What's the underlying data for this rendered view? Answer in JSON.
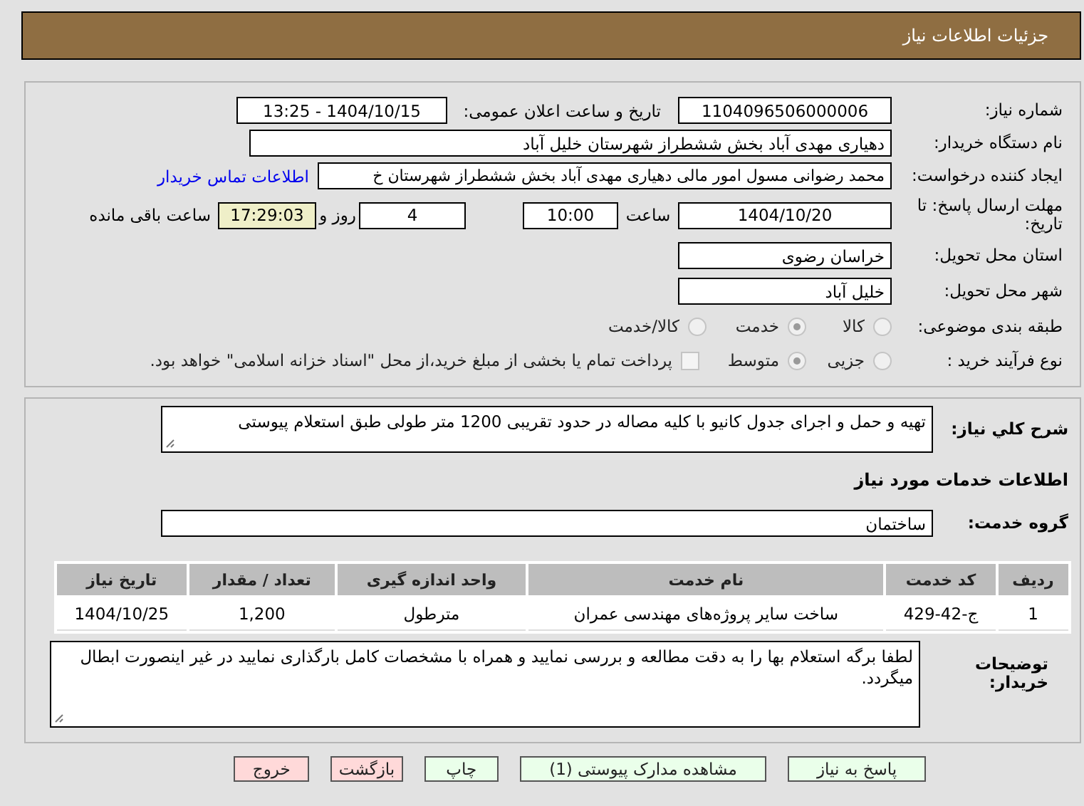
{
  "header": {
    "title": "جزئیات اطلاعات نیاز"
  },
  "details": {
    "need_number": {
      "label": "شماره نیاز:",
      "value": "1104096506000006"
    },
    "announce": {
      "label": "تاریخ و ساعت اعلان عمومی:",
      "value": "1404/10/15 - 13:25"
    },
    "buyer": {
      "label": "نام دستگاه خریدار:",
      "value": "دهیاری مهدی آباد بخش ششطراز شهرستان خلیل آباد"
    },
    "creator": {
      "label": "ایجاد کننده درخواست:",
      "value": "محمد رضوانی مسول امور مالی دهیاری مهدی آباد بخش ششطراز شهرستان خ",
      "link": "اطلاعات تماس خریدار"
    },
    "deadline": {
      "label": "مهلت ارسال پاسخ: تا تاریخ:",
      "date": "1404/10/20",
      "time_label": "ساعت",
      "time": "10:00",
      "days": "4",
      "days_label": "روز و",
      "remaining": "17:29:03",
      "remaining_label": "ساعت باقی مانده"
    },
    "province": {
      "label": "استان محل تحویل:",
      "value": "خراسان رضوی"
    },
    "city": {
      "label": "شهر محل تحویل:",
      "value": "خلیل آباد"
    },
    "category": {
      "label": "طبقه بندی موضوعی:",
      "options": [
        {
          "label": "کالا",
          "selected": false
        },
        {
          "label": "خدمت",
          "selected": true
        },
        {
          "label": "کالا/خدمت",
          "selected": false
        }
      ]
    },
    "process": {
      "label": "نوع فرآیند خرید :",
      "options": [
        {
          "label": "جزیی",
          "selected": false
        },
        {
          "label": "متوسط",
          "selected": true
        }
      ],
      "payment": {
        "checked": false,
        "text": "پرداخت تمام یا بخشی از مبلغ خرید،از محل \"اسناد خزانه اسلامی\" خواهد بود."
      }
    }
  },
  "services": {
    "description": {
      "label": "شرح کلي نياز:",
      "value": "تهیه و حمل و اجرای جدول کانیو با کلیه مصاله در حدود تقریبی 1200 متر طولی طبق استعلام پیوستی"
    },
    "section_title": "اطلاعات خدمات مورد نیاز",
    "group": {
      "label": "گروه خدمت:",
      "value": "ساختمان"
    },
    "table": {
      "columns": [
        "ردیف",
        "کد خدمت",
        "نام خدمت",
        "واحد اندازه گیری",
        "تعداد / مقدار",
        "تاریخ نیاز"
      ],
      "rows": [
        [
          "1",
          "ج-42-429",
          "ساخت سایر پروژه‌های مهندسی عمران",
          "مترطول",
          "1,200",
          "1404/10/25"
        ]
      ]
    },
    "notes": {
      "label": "توضیحات خریدار:",
      "value": "لطفا برگه استعلام بها را به دقت مطالعه و بررسی نمایید و همراه با مشخصات کامل بارگذاری نمایید در غیر اینصورت ابطال میگردد."
    }
  },
  "buttons": [
    {
      "label": "پاسخ به نیاز",
      "kind": "default"
    },
    {
      "label": "مشاهده مدارک پیوستی (1)",
      "kind": "default"
    },
    {
      "label": "چاپ",
      "kind": "default"
    },
    {
      "label": "بازگشت",
      "kind": "danger"
    },
    {
      "label": "خروج",
      "kind": "danger"
    }
  ]
}
